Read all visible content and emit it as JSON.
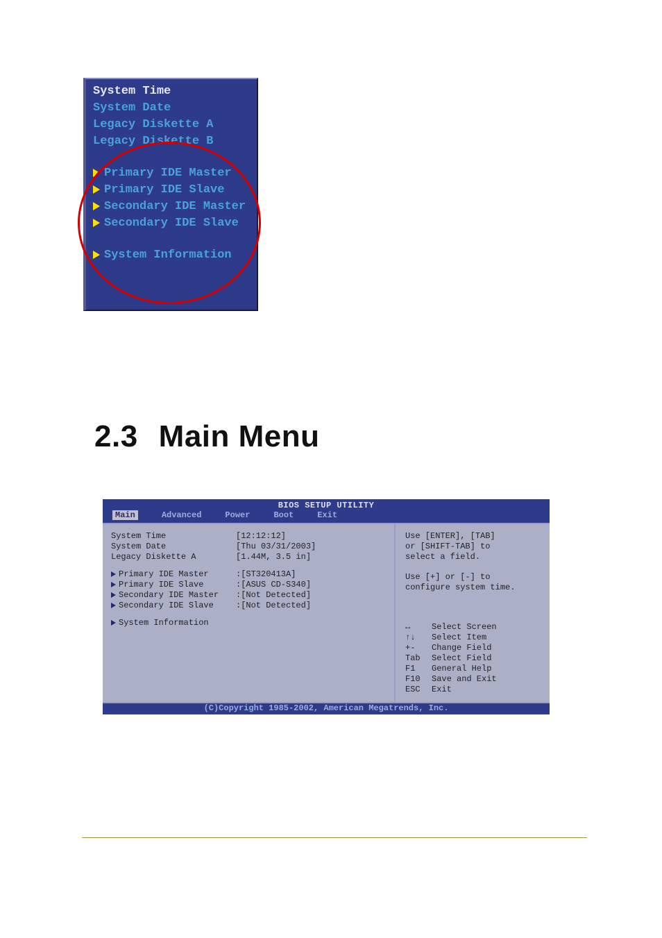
{
  "top_panel": {
    "items": [
      "System Time",
      "System Date",
      "Legacy Diskette A",
      "Legacy Diskette B"
    ],
    "subs": [
      "Primary IDE Master",
      "Primary IDE Slave",
      "Secondary IDE Master",
      "Secondary IDE Slave"
    ],
    "sysinfo": "System Information"
  },
  "heading": {
    "num": "2.3",
    "title": "Main Menu"
  },
  "bios": {
    "title": "BIOS SETUP UTILITY",
    "menu": [
      "Main",
      "Advanced",
      "Power",
      "Boot",
      "Exit"
    ],
    "active_menu": "Main",
    "fields": {
      "time_label": "System Time",
      "time_value": "[12:12:12]",
      "date_label": "System Date",
      "date_value": "[Thu 03/31/2003]",
      "diskette_label": "Legacy Diskette A",
      "diskette_value": "[1.44M, 3.5 in]"
    },
    "ide": [
      {
        "label": "Primary IDE Master",
        "value": ":[ST320413A]"
      },
      {
        "label": "Primary IDE Slave",
        "value": ":[ASUS CD-S340]"
      },
      {
        "label": "Secondary IDE Master",
        "value": ":[Not Detected]"
      },
      {
        "label": "Secondary IDE Slave",
        "value": ":[Not Detected]"
      }
    ],
    "sysinfo": "System Information",
    "help1": "Use [ENTER], [TAB]\nor [SHIFT-TAB] to\nselect a field.",
    "help2": "Use [+] or [-] to\nconfigure system time.",
    "keys": [
      {
        "k": "↔",
        "t": "Select Screen"
      },
      {
        "k": "↑↓",
        "t": "Select Item"
      },
      {
        "k": "+-",
        "t": "Change Field"
      },
      {
        "k": "Tab",
        "t": "Select Field"
      },
      {
        "k": "F1",
        "t": "General Help"
      },
      {
        "k": "F10",
        "t": "Save and Exit"
      },
      {
        "k": "ESC",
        "t": "Exit"
      }
    ],
    "copyright": "(C)Copyright 1985-2002, American Megatrends, Inc."
  }
}
